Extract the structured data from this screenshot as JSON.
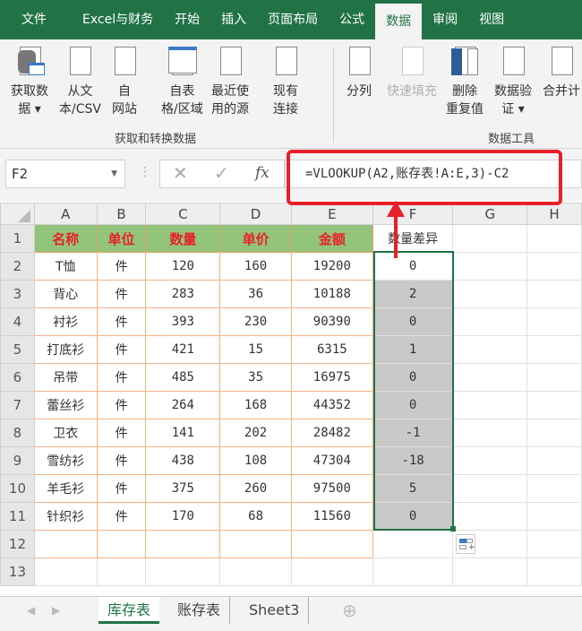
{
  "ribbon_tabs": [
    "文件",
    "Excel与财务",
    "开始",
    "插入",
    "页面布局",
    "公式",
    "数据",
    "审阅",
    "视图"
  ],
  "active_tab": "数据",
  "ribbon": {
    "buttons": [
      {
        "l1": "获取数",
        "l2": "据 ▾"
      },
      {
        "l1": "从文",
        "l2": "本/CSV"
      },
      {
        "l1": "自",
        "l2": "网站"
      },
      {
        "l1": "自表",
        "l2": "格/区域"
      },
      {
        "l1": "最近使",
        "l2": "用的源"
      },
      {
        "l1": "现有",
        "l2": "连接"
      },
      {
        "l1": "分列",
        "l2": ""
      },
      {
        "l1": "快速填充",
        "l2": ""
      },
      {
        "l1": "删除",
        "l2": "重复值"
      },
      {
        "l1": "数据验",
        "l2": "证 ▾"
      },
      {
        "l1": "合并计",
        "l2": ""
      }
    ],
    "group1": "获取和转换数据",
    "group2": "数据工具"
  },
  "formula_bar": {
    "name_box": "F2",
    "cancel": "✕",
    "enter": "✓",
    "fx": "fx",
    "formula": "=VLOOKUP(A2,账存表!A:E,3)-C2"
  },
  "columns": [
    "A",
    "B",
    "C",
    "D",
    "E",
    "F",
    "G",
    "H"
  ],
  "headers": [
    "名称",
    "单位",
    "数量",
    "单价",
    "金额",
    "数量差异"
  ],
  "rows": [
    [
      "T恤",
      "件",
      "120",
      "160",
      "19200",
      "0"
    ],
    [
      "背心",
      "件",
      "283",
      "36",
      "10188",
      "2"
    ],
    [
      "衬衫",
      "件",
      "393",
      "230",
      "90390",
      "0"
    ],
    [
      "打底衫",
      "件",
      "421",
      "15",
      "6315",
      "1"
    ],
    [
      "吊带",
      "件",
      "485",
      "35",
      "16975",
      "0"
    ],
    [
      "蕾丝衫",
      "件",
      "264",
      "168",
      "44352",
      "0"
    ],
    [
      "卫衣",
      "件",
      "141",
      "202",
      "28482",
      "-1"
    ],
    [
      "雪纺衫",
      "件",
      "438",
      "108",
      "47304",
      "-18"
    ],
    [
      "羊毛衫",
      "件",
      "375",
      "260",
      "97500",
      "5"
    ],
    [
      "针织衫",
      "件",
      "170",
      "68",
      "11560",
      "0"
    ]
  ],
  "row_numbers": [
    "1",
    "2",
    "3",
    "4",
    "5",
    "6",
    "7",
    "8",
    "9",
    "10",
    "11",
    "12",
    "13"
  ],
  "sheets": [
    "库存表",
    "账存表",
    "Sheet3"
  ],
  "active_sheet": "库存表",
  "add_sheet": "⊕"
}
